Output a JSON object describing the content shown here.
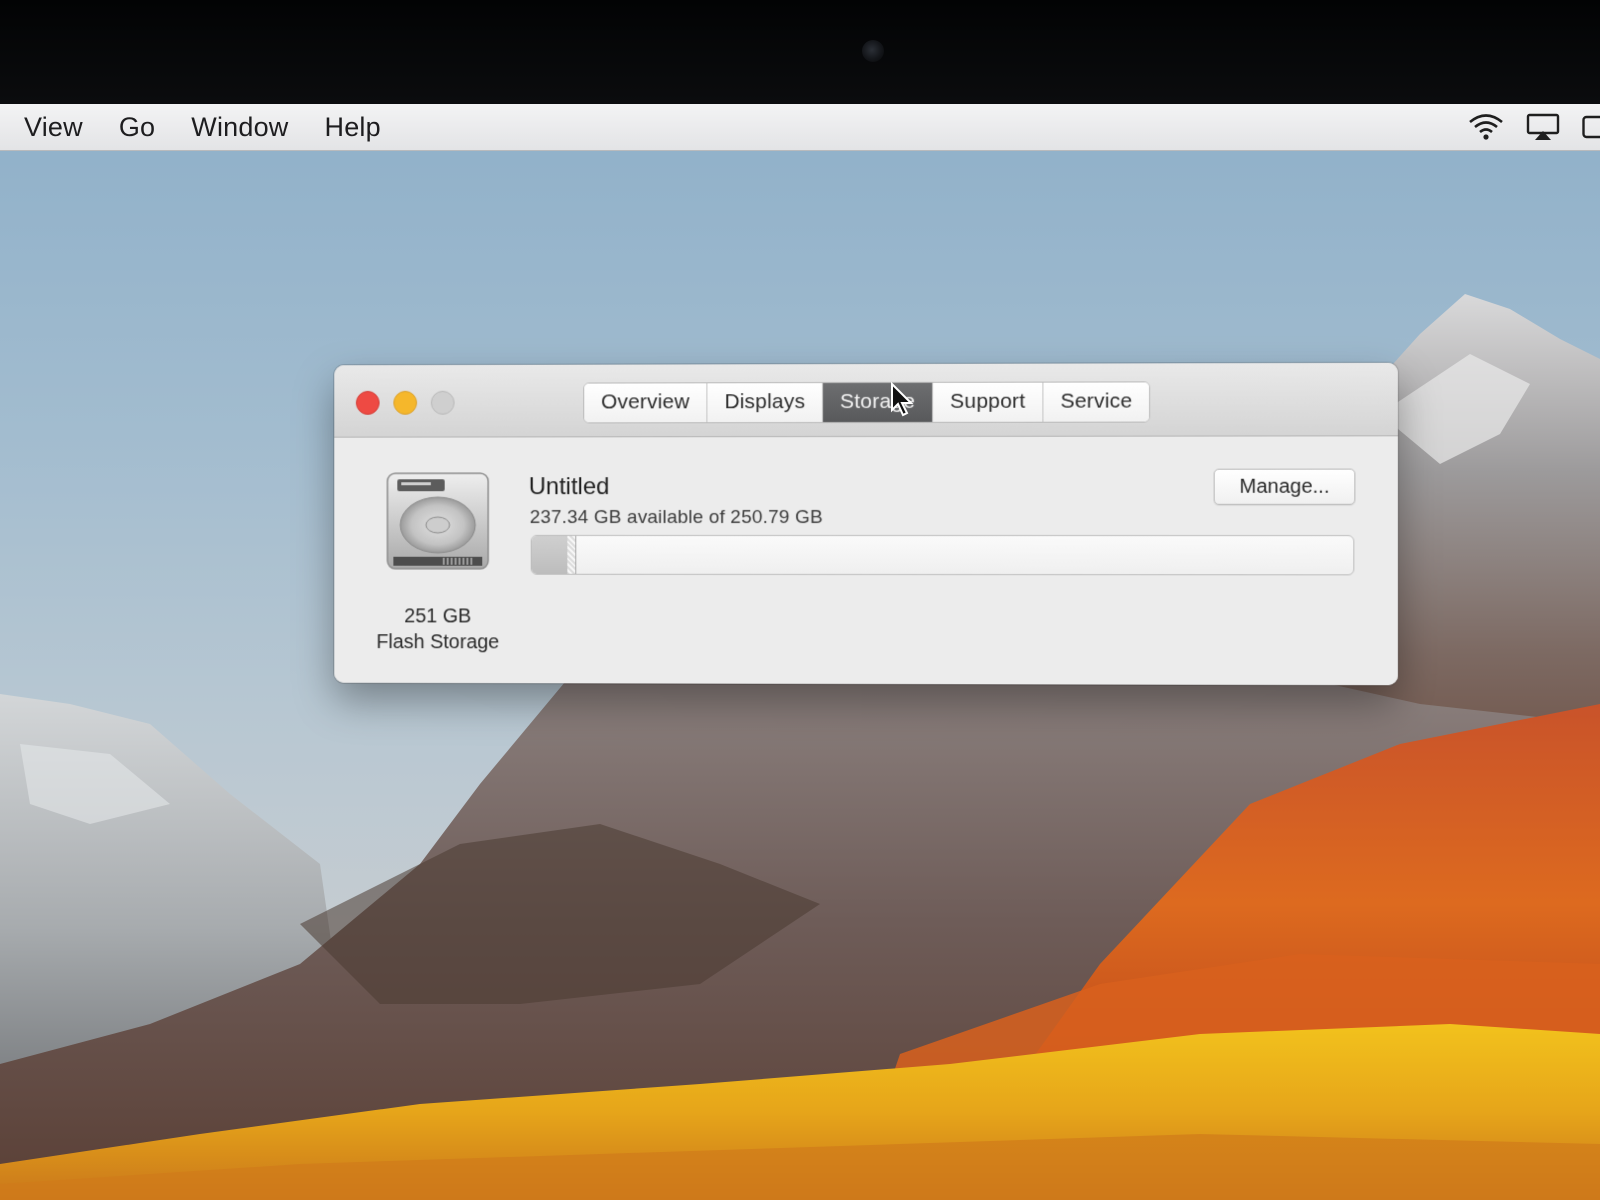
{
  "menubar": {
    "items": [
      "View",
      "Go",
      "Window",
      "Help"
    ],
    "status_icons": [
      "wifi-icon",
      "airplay-icon",
      "battery-icon"
    ]
  },
  "window": {
    "title_tabs": [
      "Overview",
      "Displays",
      "Storage",
      "Support",
      "Service"
    ],
    "active_tab": "Storage",
    "disk": {
      "capacity": "251 GB",
      "type": "Flash Storage"
    },
    "volume": {
      "name": "Untitled",
      "availability": "237.34 GB available of 250.79 GB",
      "used_fraction": 0.054
    },
    "manage_label": "Manage..."
  },
  "colors": {
    "close": "#ee4a43",
    "minimize": "#f5b72b",
    "zoom_disabled": "#cfcfcf",
    "active_tab": "#5f6062"
  }
}
